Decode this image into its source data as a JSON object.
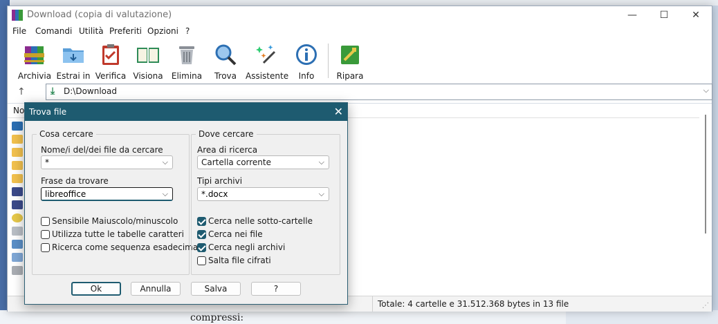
{
  "window": {
    "title": "Download (copia di valutazione)",
    "minimize": "—",
    "maximize": "☐",
    "close": "✕"
  },
  "menu": [
    "File",
    "Comandi",
    "Utilità",
    "Preferiti",
    "Opzioni",
    "?"
  ],
  "toolbar": [
    {
      "label": "Archivia",
      "icon": "archive-books-icon"
    },
    {
      "label": "Estrai in",
      "icon": "extract-folder-icon"
    },
    {
      "label": "Verifica",
      "icon": "test-clipboard-icon"
    },
    {
      "label": "Visiona",
      "icon": "view-book-icon"
    },
    {
      "label": "Elimina",
      "icon": "trash-icon"
    },
    {
      "label": "Trova",
      "icon": "magnifier-icon"
    },
    {
      "label": "Assistente",
      "icon": "wizard-wand-icon"
    },
    {
      "label": "Info",
      "icon": "info-icon"
    },
    {
      "label": "Ripara",
      "icon": "repair-icon"
    }
  ],
  "address": {
    "up": "↑",
    "path": "D:\\Download",
    "chevron": "⌵"
  },
  "filelist": {
    "column_name": "No"
  },
  "status": {
    "text": "Totale: 4 cartelle e 31.512.368 bytes in 13 file"
  },
  "background": {
    "bottom_text": "compressi:"
  },
  "dialog": {
    "title": "Trova file",
    "close": "✕",
    "what": {
      "group": "Cosa cercare",
      "name_label": "Nome/i del/dei file da cercare",
      "name_value": "*",
      "phrase_label": "Frase da trovare",
      "phrase_value": "libreoffice",
      "options": [
        {
          "label": "Sensibile Maiuscolo/minuscolo",
          "checked": false
        },
        {
          "label": "Utilizza tutte le tabelle caratteri",
          "checked": false
        },
        {
          "label": "Ricerca come sequenza esadecimale",
          "checked": false
        }
      ]
    },
    "where": {
      "group": "Dove cercare",
      "area_label": "Area di ricerca",
      "area_value": "Cartella corrente",
      "types_label": "Tipi archivi",
      "types_value": "*.docx",
      "options": [
        {
          "label": "Cerca nelle sotto-cartelle",
          "checked": true
        },
        {
          "label": "Cerca nei file",
          "checked": true
        },
        {
          "label": "Cerca negli archivi",
          "checked": true
        },
        {
          "label": "Salta file cifrati",
          "checked": false
        }
      ]
    },
    "buttons": {
      "ok": "Ok",
      "cancel": "Annulla",
      "save": "Salva",
      "help": "?"
    }
  },
  "colors": {
    "dialog_title_bg": "#1e5b70",
    "checkbox_checked": "#1e5b70"
  }
}
